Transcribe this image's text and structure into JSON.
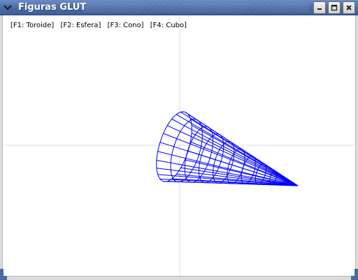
{
  "window": {
    "title": "Figuras GLUT",
    "controls": {
      "menu_icon": "chevron-down-icon",
      "minimize_icon": "minimize-icon",
      "maximize_icon": "maximize-icon",
      "close_icon": "close-icon"
    }
  },
  "canvas": {
    "menu_options": [
      "[F1: Toroide]",
      "[F2: Esfera]",
      "[F3: Cono]",
      "[F4: Cubo]"
    ],
    "figure": "cone-wireframe",
    "colors": {
      "wireframe": "#0000ff",
      "axes": "#dcdcdc",
      "background": "#ffffff",
      "titlebar": "#4a6aa6"
    }
  }
}
